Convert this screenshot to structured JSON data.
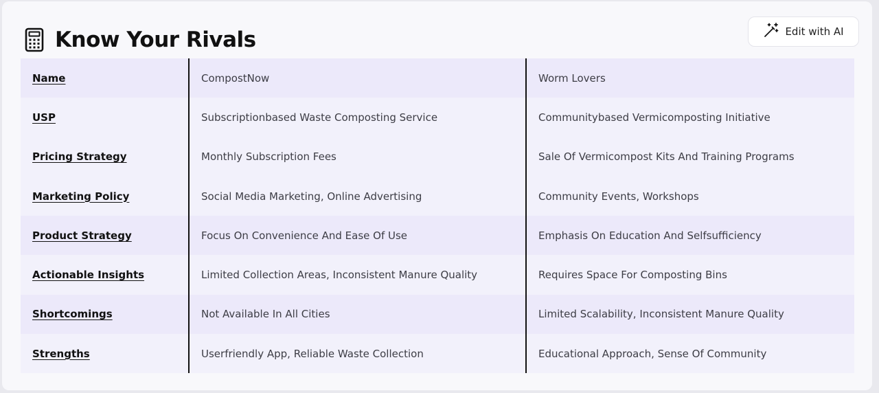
{
  "header": {
    "title": "Know Your Rivals",
    "title_icon": "calculator-icon",
    "edit_button": {
      "label": "Edit with AI",
      "icon": "magic-wand-icon"
    }
  },
  "table": {
    "rows": [
      {
        "label": "Name",
        "c1": "CompostNow",
        "c2": "Worm Lovers"
      },
      {
        "label": "USP",
        "c1": "Subscriptionbased Waste Composting Service",
        "c2": "Communitybased Vermicomposting Initiative"
      },
      {
        "label": "Pricing Strategy",
        "c1": "Monthly Subscription Fees",
        "c2": "Sale Of Vermicompost Kits And Training Programs"
      },
      {
        "label": "Marketing Policy",
        "c1": "Social Media Marketing, Online Advertising",
        "c2": "Community Events, Workshops"
      },
      {
        "label": "Product Strategy",
        "c1": "Focus On Convenience And Ease Of Use",
        "c2": "Emphasis On Education And Selfsufficiency"
      },
      {
        "label": "Actionable Insights",
        "c1": "Limited Collection Areas, Inconsistent Manure Quality",
        "c2": "Requires Space For Composting Bins"
      },
      {
        "label": "Shortcomings",
        "c1": "Not Available In All Cities",
        "c2": "Limited Scalability, Inconsistent Manure Quality"
      },
      {
        "label": "Strengths",
        "c1": "Userfriendly App, Reliable Waste Collection",
        "c2": "Educational Approach, Sense Of Community"
      }
    ]
  },
  "colors": {
    "row_odd": "#ece9fa",
    "row_even": "#f2f1fb",
    "card_bg": "#f8f8fb"
  }
}
